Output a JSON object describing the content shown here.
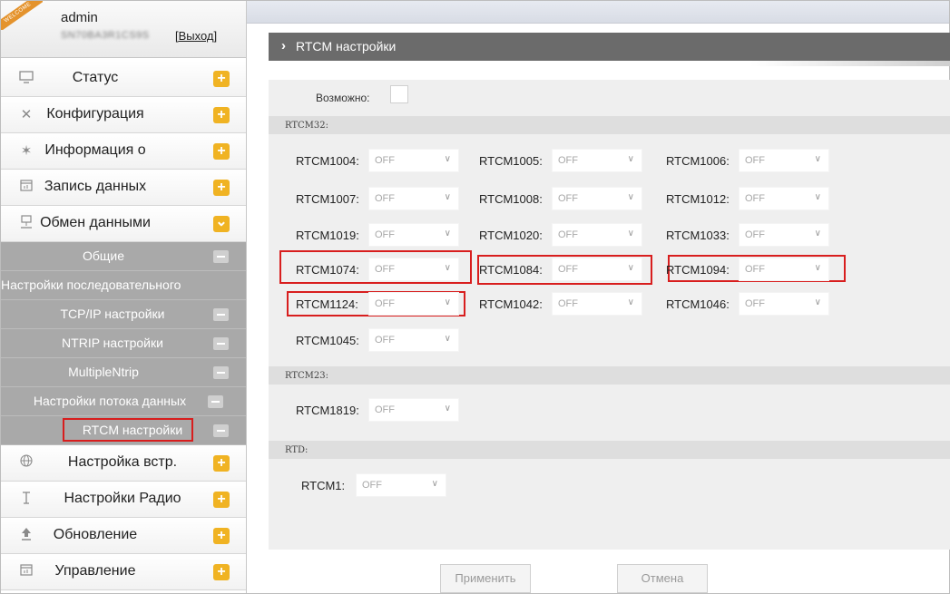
{
  "user": {
    "ribbon": "WELCOME",
    "name": "admin",
    "serial": "SN70BA3R1CS9S",
    "logout": "[Выход]"
  },
  "menu": [
    {
      "label": "Статус",
      "icon": "monitor-icon"
    },
    {
      "label": "Конфигурация",
      "icon": "tools-icon"
    },
    {
      "label": "Информация о",
      "icon": "satellite-icon"
    },
    {
      "label": "Запись данных",
      "icon": "calendar-icon"
    },
    {
      "label": "Обмен данными",
      "icon": "network-icon"
    }
  ],
  "submenu": [
    {
      "label": "Общие"
    },
    {
      "label": "Настройки последовательного"
    },
    {
      "label": "TCP/IP настройки"
    },
    {
      "label": "NTRIP настройки"
    },
    {
      "label": "MultipleNtrip"
    },
    {
      "label": "Настройки потока данных"
    },
    {
      "label": "RTCM настройки"
    }
  ],
  "menu_bottom": [
    {
      "label": "Настройка встр.",
      "icon": "globe-icon"
    },
    {
      "label": "Настройки Радио",
      "icon": "antenna-icon"
    },
    {
      "label": "Обновление",
      "icon": "upload-icon"
    },
    {
      "label": "Управление",
      "icon": "calendar-icon"
    }
  ],
  "page": {
    "title": "RTCM настройки",
    "possible_label": "Возможно:"
  },
  "groups": {
    "rtcm32": "RTCM32:",
    "rtcm23": "RTCM23:",
    "rtd": "RTD:"
  },
  "fields": {
    "rtcm1004": {
      "label": "RTCM1004:",
      "value": "OFF"
    },
    "rtcm1005": {
      "label": "RTCM1005:",
      "value": "OFF"
    },
    "rtcm1006": {
      "label": "RTCM1006:",
      "value": "OFF"
    },
    "rtcm1007": {
      "label": "RTCM1007:",
      "value": "OFF"
    },
    "rtcm1008": {
      "label": "RTCM1008:",
      "value": "OFF"
    },
    "rtcm1012": {
      "label": "RTCM1012:",
      "value": "OFF"
    },
    "rtcm1019": {
      "label": "RTCM1019:",
      "value": "OFF"
    },
    "rtcm1020": {
      "label": "RTCM1020:",
      "value": "OFF"
    },
    "rtcm1033": {
      "label": "RTCM1033:",
      "value": "OFF"
    },
    "rtcm1074": {
      "label": "RTCM1074:",
      "value": "OFF"
    },
    "rtcm1084": {
      "label": "RTCM1084:",
      "value": "OFF"
    },
    "rtcm1094": {
      "label": "RTCM1094:",
      "value": "OFF"
    },
    "rtcm1124": {
      "label": "RTCM1124:",
      "value": "OFF"
    },
    "rtcm1042": {
      "label": "RTCM1042:",
      "value": "OFF"
    },
    "rtcm1046": {
      "label": "RTCM1046:",
      "value": "OFF"
    },
    "rtcm1045": {
      "label": "RTCM1045:",
      "value": "OFF"
    },
    "rtcm1819": {
      "label": "RTCM1819:",
      "value": "OFF"
    },
    "rtcm1": {
      "label": "RTCM1:",
      "value": "OFF"
    }
  },
  "buttons": {
    "apply": "Применить",
    "cancel": "Отмена"
  },
  "colors": {
    "accent_plus": "#f0b323",
    "highlight": "#d81e1e",
    "header": "#6b6b6b",
    "submenu": "#a9a9a9"
  }
}
